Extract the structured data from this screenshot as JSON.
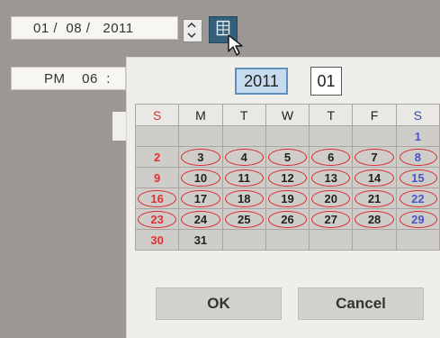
{
  "date_field": {
    "value": "01 /  08 /   2011"
  },
  "time_field": {
    "value": "PM    06  :"
  },
  "calendar": {
    "year": "2011",
    "month": "01",
    "weekday_headers": [
      "S",
      "M",
      "T",
      "W",
      "T",
      "F",
      "S"
    ],
    "weeks": [
      [
        "",
        "",
        "",
        "",
        "",
        "",
        "1"
      ],
      [
        "2",
        "3",
        "4",
        "5",
        "6",
        "7",
        "8"
      ],
      [
        "9",
        "10",
        "11",
        "12",
        "13",
        "14",
        "15"
      ],
      [
        "16",
        "17",
        "18",
        "19",
        "20",
        "21",
        "22"
      ],
      [
        "23",
        "24",
        "25",
        "26",
        "27",
        "28",
        "29"
      ],
      [
        "30",
        "31",
        "",
        "",
        "",
        "",
        ""
      ]
    ],
    "circled_days": [
      "3",
      "4",
      "5",
      "6",
      "7",
      "8",
      "10",
      "11",
      "12",
      "13",
      "14",
      "15",
      "16",
      "17",
      "18",
      "19",
      "20",
      "21",
      "22",
      "23",
      "24",
      "25",
      "26",
      "27",
      "28",
      "29"
    ],
    "ok_label": "OK",
    "cancel_label": "Cancel"
  },
  "colors": {
    "sunday": "#e03131",
    "saturday": "#2f4fb0",
    "circle": "#d62a2a",
    "year_highlight": "#c6dcee"
  },
  "icons": {
    "spin": "up-down-arrows-icon",
    "calendar": "calendar-grid-icon",
    "cursor": "mouse-pointer-icon"
  }
}
